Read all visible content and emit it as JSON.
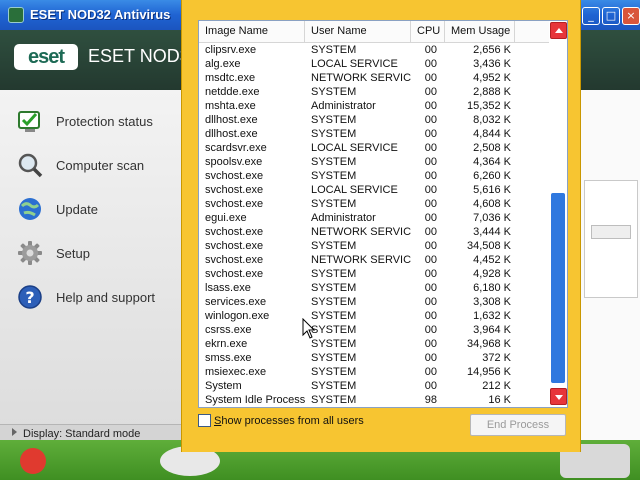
{
  "window": {
    "title": "ESET NOD32 Antivirus",
    "product_name": "ESET NOD32",
    "logo_text": "eset",
    "controls": [
      "minimize",
      "maximize",
      "close"
    ]
  },
  "sidebar": {
    "items": [
      {
        "label": "Protection status",
        "icon": "shield-check-icon"
      },
      {
        "label": "Computer scan",
        "icon": "magnifier-icon"
      },
      {
        "label": "Update",
        "icon": "globe-icon"
      },
      {
        "label": "Setup",
        "icon": "gear-icon"
      },
      {
        "label": "Help and support",
        "icon": "help-icon"
      }
    ],
    "display_mode": "Display: Standard mode"
  },
  "taskman": {
    "columns": [
      "Image Name",
      "User Name",
      "CPU",
      "Mem Usage"
    ],
    "processes": [
      {
        "name": "clipsrv.exe",
        "user": "SYSTEM",
        "cpu": "00",
        "mem": "2,656 K"
      },
      {
        "name": "alg.exe",
        "user": "LOCAL SERVICE",
        "cpu": "00",
        "mem": "3,436 K"
      },
      {
        "name": "msdtc.exe",
        "user": "NETWORK SERVICE",
        "cpu": "00",
        "mem": "4,952 K"
      },
      {
        "name": "netdde.exe",
        "user": "SYSTEM",
        "cpu": "00",
        "mem": "2,888 K"
      },
      {
        "name": "mshta.exe",
        "user": "Administrator",
        "cpu": "00",
        "mem": "15,352 K"
      },
      {
        "name": "dllhost.exe",
        "user": "SYSTEM",
        "cpu": "00",
        "mem": "8,032 K"
      },
      {
        "name": "dllhost.exe",
        "user": "SYSTEM",
        "cpu": "00",
        "mem": "4,844 K"
      },
      {
        "name": "scardsvr.exe",
        "user": "LOCAL SERVICE",
        "cpu": "00",
        "mem": "2,508 K"
      },
      {
        "name": "spoolsv.exe",
        "user": "SYSTEM",
        "cpu": "00",
        "mem": "4,364 K"
      },
      {
        "name": "svchost.exe",
        "user": "SYSTEM",
        "cpu": "00",
        "mem": "6,260 K"
      },
      {
        "name": "svchost.exe",
        "user": "LOCAL SERVICE",
        "cpu": "00",
        "mem": "5,616 K"
      },
      {
        "name": "svchost.exe",
        "user": "SYSTEM",
        "cpu": "00",
        "mem": "4,608 K"
      },
      {
        "name": "egui.exe",
        "user": "Administrator",
        "cpu": "00",
        "mem": "7,036 K"
      },
      {
        "name": "svchost.exe",
        "user": "NETWORK SERVICE",
        "cpu": "00",
        "mem": "3,444 K"
      },
      {
        "name": "svchost.exe",
        "user": "SYSTEM",
        "cpu": "00",
        "mem": "34,508 K"
      },
      {
        "name": "svchost.exe",
        "user": "NETWORK SERVICE",
        "cpu": "00",
        "mem": "4,452 K"
      },
      {
        "name": "svchost.exe",
        "user": "SYSTEM",
        "cpu": "00",
        "mem": "4,928 K"
      },
      {
        "name": "lsass.exe",
        "user": "SYSTEM",
        "cpu": "00",
        "mem": "6,180 K"
      },
      {
        "name": "services.exe",
        "user": "SYSTEM",
        "cpu": "00",
        "mem": "3,308 K"
      },
      {
        "name": "winlogon.exe",
        "user": "SYSTEM",
        "cpu": "00",
        "mem": "1,632 K"
      },
      {
        "name": "csrss.exe",
        "user": "SYSTEM",
        "cpu": "00",
        "mem": "3,964 K"
      },
      {
        "name": "ekrn.exe",
        "user": "SYSTEM",
        "cpu": "00",
        "mem": "34,968 K"
      },
      {
        "name": "smss.exe",
        "user": "SYSTEM",
        "cpu": "00",
        "mem": "372 K"
      },
      {
        "name": "msiexec.exe",
        "user": "SYSTEM",
        "cpu": "00",
        "mem": "14,956 K"
      },
      {
        "name": "System",
        "user": "SYSTEM",
        "cpu": "00",
        "mem": "212 K"
      },
      {
        "name": "System Idle Process",
        "user": "SYSTEM",
        "cpu": "98",
        "mem": "16 K"
      }
    ],
    "show_all_label_prefix": "",
    "show_all_label_accel": "S",
    "show_all_label_rest": "how processes from all users",
    "show_all_checked": false,
    "end_process_label": "End Process",
    "end_process_enabled": false
  },
  "colors": {
    "taskman_bg": "#f7c531",
    "scroll_button": "#e7353a",
    "scroll_thumb": "#2f78df",
    "eset_header": "#2f4f3f"
  }
}
